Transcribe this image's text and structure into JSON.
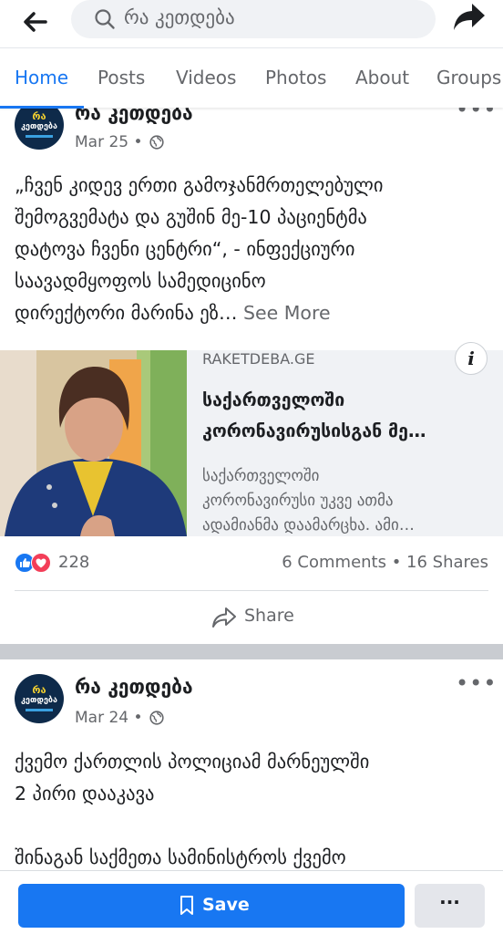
{
  "search": {
    "text": "რა კეთდება"
  },
  "tabs": [
    {
      "label": "Home",
      "active": true
    },
    {
      "label": "Posts"
    },
    {
      "label": "Videos"
    },
    {
      "label": "Photos"
    },
    {
      "label": "About"
    },
    {
      "label": "Groups"
    }
  ],
  "posts": [
    {
      "page_name": "რა კეთდება",
      "avatar_text": [
        "რა",
        "კეთდება"
      ],
      "date": "Mar 25",
      "text_lines": [
        "„ჩვენ კიდევ ერთი გამოჯანმრთელებული",
        "შემოგვემატა და გუშინ მე-10 პაციენტმა",
        "დატოვა ჩვენი ცენტრი“, - ინფექციური",
        "საავადმყოფოს სამედიცინო",
        "დირექტორი მარინა ეზ…"
      ],
      "see_more": "See More",
      "link": {
        "domain": "RAKETDEBA.GE",
        "title_lines": [
          "საქართველოში",
          "კორონავირუსისგან მე…"
        ],
        "desc_lines": [
          "საქართველოში",
          "კორონავირუსი უკვე ათმა",
          "ადამიანმა დაამარცხა. ამი…"
        ]
      },
      "reaction_count": "228",
      "stats": "6 Comments • 16 Shares",
      "share_label": "Share"
    },
    {
      "page_name": "რა კეთდება",
      "date": "Mar 24",
      "text_lines": [
        "ქვემო ქართლის პოლიციამ მარნეულში",
        "2 პირი დააკავა",
        "",
        "შინაგან საქმეთა სამინისტროს ქვემო"
      ]
    }
  ],
  "bottom_bar": {
    "save_label": "Save",
    "more_label": "···"
  },
  "colors": {
    "accent": "#1877f2",
    "love": "#f33e58",
    "muted": "#65676b"
  }
}
